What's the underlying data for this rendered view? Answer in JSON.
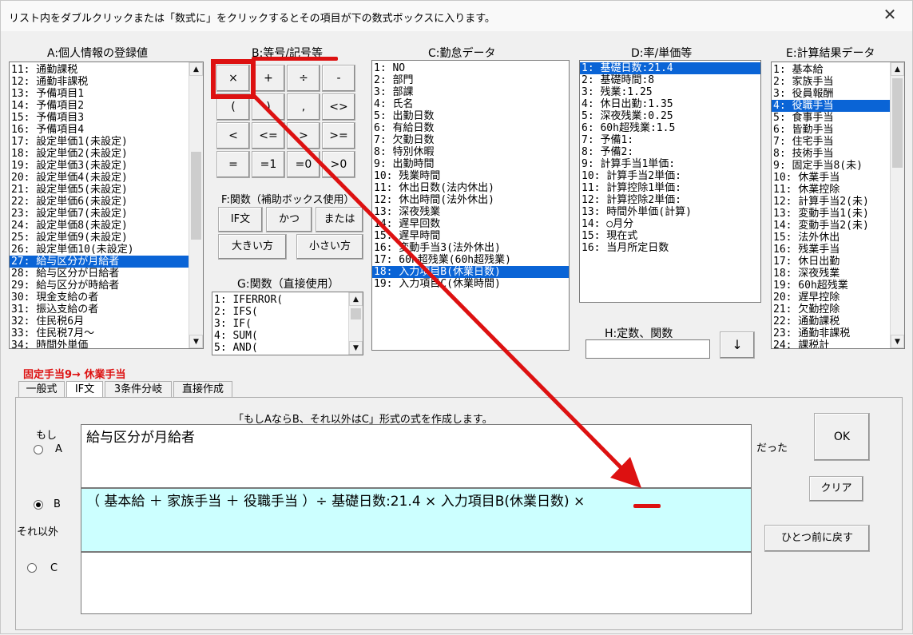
{
  "window": {
    "title": "リスト内をダブルクリックまたは「数式に」をクリックするとその項目が下の数式ボックスに入ります。",
    "close_glyph": "✕"
  },
  "section_a": {
    "label": "A:個人情報の登録値",
    "items": [
      "11: 通勤課税",
      "12: 通勤非課税",
      "13: 予備項目1",
      "14: 予備項目2",
      "15: 予備項目3",
      "16: 予備項目4",
      "17: 設定単価1(未設定)",
      "18: 設定単価2(未設定)",
      "19: 設定単価3(未設定)",
      "20: 設定単価4(未設定)",
      "21: 設定単価5(未設定)",
      "22: 設定単価6(未設定)",
      "23: 設定単価7(未設定)",
      "24: 設定単価8(未設定)",
      "25: 設定単価9(未設定)",
      "26: 設定単価10(未設定)",
      "27: 給与区分が月給者",
      "28: 給与区分が日給者",
      "29: 給与区分が時給者",
      "30: 現金支給の者",
      "31: 振込支給の者",
      "32: 住民税6月",
      "33: 住民税7月～",
      "34: 時間外単価"
    ],
    "selected_index": 16
  },
  "section_b": {
    "label": "B:等号/記号等",
    "buttons": [
      "×",
      "+",
      "÷",
      "-",
      "(",
      ")",
      ",",
      "<>",
      "<",
      "<=",
      ">",
      ">=",
      "=",
      "=1",
      "=0",
      ">0"
    ]
  },
  "section_f": {
    "label": "F:関数（補助ボックス使用）",
    "buttons": [
      "IF文",
      "かつ",
      "または",
      "大きい方",
      "小さい方"
    ]
  },
  "section_g": {
    "label": "G:関数（直接使用）",
    "items": [
      "1: IFERROR(",
      "2: IFS(",
      "3: IF(",
      "4: SUM(",
      "5: AND("
    ]
  },
  "section_c": {
    "label": "C:勤怠データ",
    "items": [
      "1: NO",
      "2: 部門",
      "3: 部課",
      "4: 氏名",
      "5: 出勤日数",
      "6: 有給日数",
      "7: 欠勤日数",
      "8: 特別休暇",
      "9: 出勤時間",
      "10: 残業時間",
      "11: 休出日数(法内休出)",
      "12: 休出時間(法外休出)",
      "13: 深夜残業",
      "14: 遅早回数",
      "15: 遅早時間",
      "16: 変動手当3(法外休出)",
      "17: 60h超残業(60h超残業)",
      "18: 入力項目B(休業日数)",
      "19: 入力項目C(休業時間)"
    ],
    "selected_index": 17
  },
  "section_d": {
    "label": "D:率/単価等",
    "items": [
      "1: 基礎日数:21.4",
      "2: 基礎時間:8",
      "3: 残業:1.25",
      "4: 休日出勤:1.35",
      "5: 深夜残業:0.25",
      "6: 60h超残業:1.5",
      "7: 予備1:",
      "8: 予備2:",
      "9: 計算手当1単価:",
      "10: 計算手当2単価:",
      "11: 計算控除1単価:",
      "12: 計算控除2単価:",
      "13: 時間外単価(計算)",
      "14: ○月分",
      "15: 現在式",
      "16: 当月所定日数"
    ],
    "selected_index": 0
  },
  "section_h": {
    "label": "H:定数、関数",
    "value": "",
    "down_button": "↓"
  },
  "section_e": {
    "label": "E:計算結果データ",
    "items": [
      "1: 基本給",
      "2: 家族手当",
      "3: 役員報酬",
      "4: 役職手当",
      "5: 食事手当",
      "6: 皆勤手当",
      "7: 住宅手当",
      "8: 技術手当",
      "9: 固定手当8(未)",
      "10: 休業手当",
      "11: 休業控除",
      "12: 計算手当2(未)",
      "13: 変動手当1(未)",
      "14: 変動手当2(未)",
      "15: 法外休出",
      "16: 残業手当",
      "17: 休日出勤",
      "18: 深夜残業",
      "19: 60h超残業",
      "20: 遅早控除",
      "21: 欠勤控除",
      "22: 通勤課税",
      "23: 通勤非課税",
      "24: 課税計"
    ],
    "selected_index": 3
  },
  "target_label": "固定手当9→ 休業手当",
  "tabs": [
    "一般式",
    "IF文",
    "3条件分岐",
    "直接作成"
  ],
  "active_tab": 1,
  "if_panel": {
    "description": "「もしAならB、それ以外はC」形式の式を作成します。",
    "label_moshi": "もし",
    "label_datta": "だった",
    "label_soreigai": "それ以外",
    "radio_a": "A",
    "radio_b": "B",
    "radio_c": "C",
    "formula_a": "給与区分が月給者",
    "formula_b": "（ 基本給 ＋ 家族手当 ＋ 役職手当 ）÷ 基礎日数:21.4 × 入力項目B(休業日数) ×",
    "formula_c": "",
    "ok_button": "OK",
    "clear_button": "クリア",
    "undo_button": "ひとつ前に戻す"
  },
  "colors": {
    "selection": "#0a64d6",
    "highlight_cyan": "#ccffff",
    "annotation_red": "#dd1111"
  }
}
